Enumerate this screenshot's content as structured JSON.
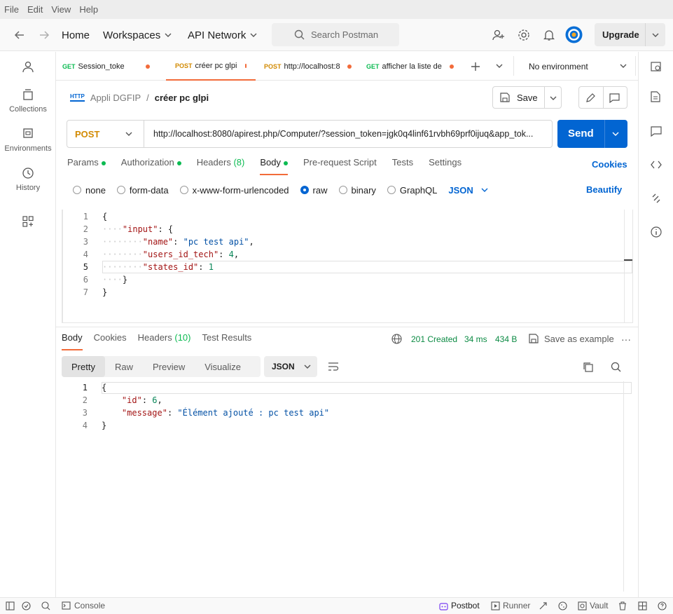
{
  "menu": [
    "File",
    "Edit",
    "View",
    "Help"
  ],
  "header": {
    "home": "Home",
    "workspaces": "Workspaces",
    "api_network": "API Network",
    "search_placeholder": "Search Postman",
    "upgrade": "Upgrade"
  },
  "sidebar": {
    "collections": "Collections",
    "environments": "Environments",
    "history": "History"
  },
  "tabs": [
    {
      "method": "GET",
      "label": "Session_toke",
      "method_color": "#0cbb52"
    },
    {
      "method": "POST",
      "label": "créer pc glpi",
      "method_color": "#d28a02"
    },
    {
      "method": "POST",
      "label": "http://localhost:8",
      "method_color": "#d28a02"
    },
    {
      "method": "GET",
      "label": "afficher la liste de",
      "method_color": "#0cbb52"
    }
  ],
  "environment": "No environment",
  "breadcrumb": {
    "collection": "Appli DGFIP",
    "separator": "/",
    "request": "créer pc glpi",
    "icon_text": "HTTP"
  },
  "save_label": "Save",
  "request": {
    "method": "POST",
    "url": "http://localhost:8080/apirest.php/Computer/?session_token=jgk0q4linf61rvbh69prf0ijuq&app_tok...",
    "send": "Send"
  },
  "req_tabs": {
    "params": "Params",
    "authorization": "Authorization",
    "headers": "Headers",
    "headers_count": "(8)",
    "body": "Body",
    "prerequest": "Pre-request Script",
    "tests": "Tests",
    "settings": "Settings",
    "cookies": "Cookies"
  },
  "body_types": {
    "none": "none",
    "form_data": "form-data",
    "urlencoded": "x-www-form-urlencoded",
    "raw": "raw",
    "binary": "binary",
    "graphql": "GraphQL",
    "json": "JSON",
    "beautify": "Beautify"
  },
  "request_body": {
    "line_numbers": [
      "1",
      "2",
      "3",
      "4",
      "5",
      "6",
      "7"
    ],
    "l1": "{",
    "l2_key": "\"input\"",
    "l2_rest": ": {",
    "l3_key": "\"name\"",
    "l3_val": "\"pc test api\"",
    "l4_key": "\"users_id_tech\"",
    "l4_val": "4",
    "l5_key": "\"states_id\"",
    "l5_val": "1",
    "l6": "}",
    "l7": "}"
  },
  "response": {
    "tabs": {
      "body": "Body",
      "cookies": "Cookies",
      "headers": "Headers",
      "headers_count": "(10)",
      "test_results": "Test Results"
    },
    "status": "201 Created",
    "time": "34 ms",
    "size": "434 B",
    "save_example": "Save as example",
    "views": {
      "pretty": "Pretty",
      "raw": "Raw",
      "preview": "Preview",
      "visualize": "Visualize"
    },
    "format": "JSON",
    "line_numbers": [
      "1",
      "2",
      "3",
      "4"
    ],
    "l1": "{",
    "l2_key": "\"id\"",
    "l2_val": "6",
    "l3_key": "\"message\"",
    "l3_val": "\"Élément ajouté : pc test api\"",
    "l4": "}"
  },
  "footer": {
    "console": "Console",
    "postbot": "Postbot",
    "runner": "Runner",
    "vault": "Vault"
  },
  "colors": {
    "accent": "#0265d2",
    "orange": "#f26b3a",
    "green": "#0cbb52"
  }
}
